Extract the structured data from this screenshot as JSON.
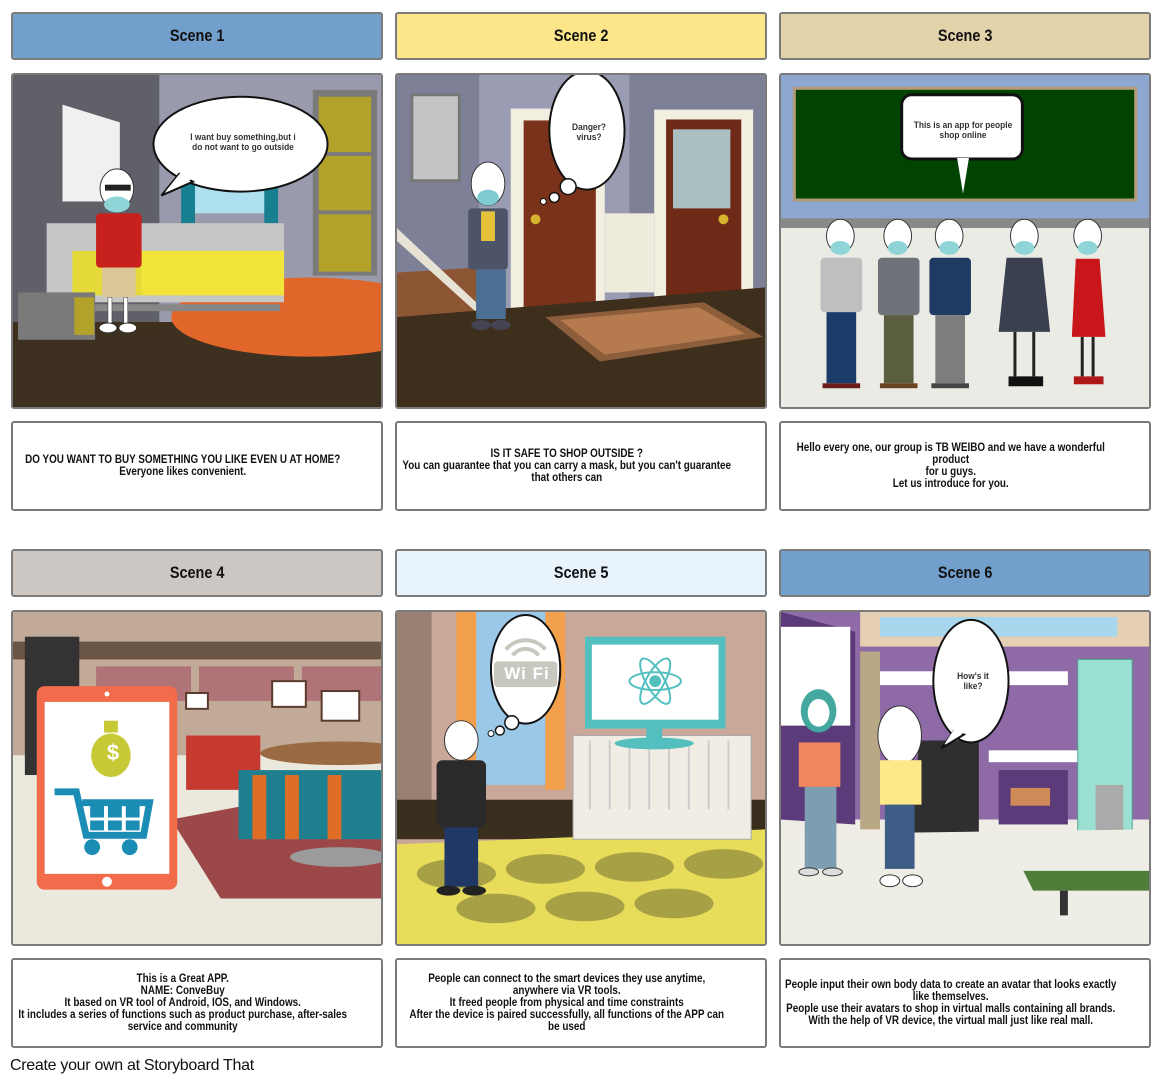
{
  "scenes": [
    {
      "title": "Scene 1",
      "header_color": "#729fcb",
      "bubble": "I want buy something,but i\ndo not want to go outside",
      "caption": "DO YOU WANT TO BUY SOMETHING YOU LIKE EVEN U AT HOME?\nEveryone likes convenient."
    },
    {
      "title": "Scene 2",
      "header_color": "#fde68a",
      "bubble": "Danger?\nvirus?",
      "caption": "IS IT SAFE TO SHOP OUTSIDE ?\nYou can guarantee that you can carry a mask, but you can't guarantee\nthat others can"
    },
    {
      "title": "Scene 3",
      "header_color": "#e2d3aa",
      "bubble": "This is an app for people\nshop online",
      "caption": "Hello every one, our group is TB WEIBO and we have a wonderful product\nfor u guys.\nLet us introduce for you."
    },
    {
      "title": "Scene 4",
      "header_color": "#ccc7c2",
      "icon_label": "$",
      "caption": "This is a Great APP.\nNAME: ConveBuy\nIt based on VR tool of Android, IOS, and Windows.\nIt includes a series of functions such as product purchase, after-sales\nservice and community"
    },
    {
      "title": "Scene 5",
      "header_color": "#e8f3fc",
      "bubble": "Wi Fi",
      "caption": "People can connect to the smart devices they use anytime,\nanywhere via VR tools.\nIt freed people from physical and time constraints\nAfter the device is paired successfully, all functions of the APP can\nbe used"
    },
    {
      "title": "Scene 6",
      "header_color": "#729fcb",
      "bubble": "How's it\nlike?",
      "caption": "People input their own body data to create an avatar that looks exactly\nlike themselves.\nPeople use their avatars to shop in virtual malls containing all brands.\nWith the help of VR device, the virtual  mall just like real mall."
    }
  ],
  "footer": "Create your own at Storyboard That"
}
